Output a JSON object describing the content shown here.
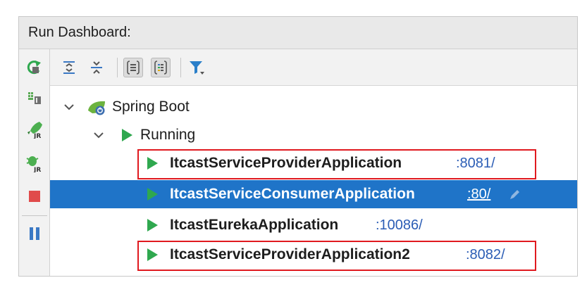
{
  "panel": {
    "title": "Run Dashboard:"
  },
  "left_toolbar": {
    "items": [
      {
        "icon": "rerun-icon"
      },
      {
        "icon": "run-configurations-icon"
      },
      {
        "icon": "run-jrebel-icon"
      },
      {
        "icon": "debug-jrebel-icon"
      },
      {
        "icon": "stop-icon",
        "color": "#e04b4b"
      },
      {
        "icon": "pause-icon",
        "color": "#3a78c4"
      }
    ]
  },
  "top_toolbar": {
    "items": [
      {
        "icon": "expand-all-icon"
      },
      {
        "icon": "collapse-all-icon"
      },
      {
        "icon": "group-by-type-icon",
        "toggled": true
      },
      {
        "icon": "group-by-status-icon",
        "toggled": true
      },
      {
        "icon": "filter-icon",
        "color": "#2a7fc9"
      }
    ]
  },
  "tree": {
    "root": {
      "label": "Spring Boot",
      "icon": "spring-boot-icon"
    },
    "group": {
      "label": "Running"
    },
    "apps": [
      {
        "name": "ItcastServiceProviderApplication",
        "port": ":8081/",
        "selected": false,
        "highlighted": true
      },
      {
        "name": "ItcastServiceConsumerApplication",
        "port": ":80/",
        "selected": true,
        "highlighted": false
      },
      {
        "name": "ItcastEurekaApplication",
        "port": ":10086/",
        "selected": false,
        "highlighted": false
      },
      {
        "name": "ItcastServiceProviderApplication2",
        "port": ":8082/",
        "selected": false,
        "highlighted": true
      }
    ]
  },
  "colors": {
    "selection": "#1f74c8",
    "run_green": "#2fa84f",
    "port_blue": "#2b5db5",
    "highlight_red": "#e0191f"
  }
}
